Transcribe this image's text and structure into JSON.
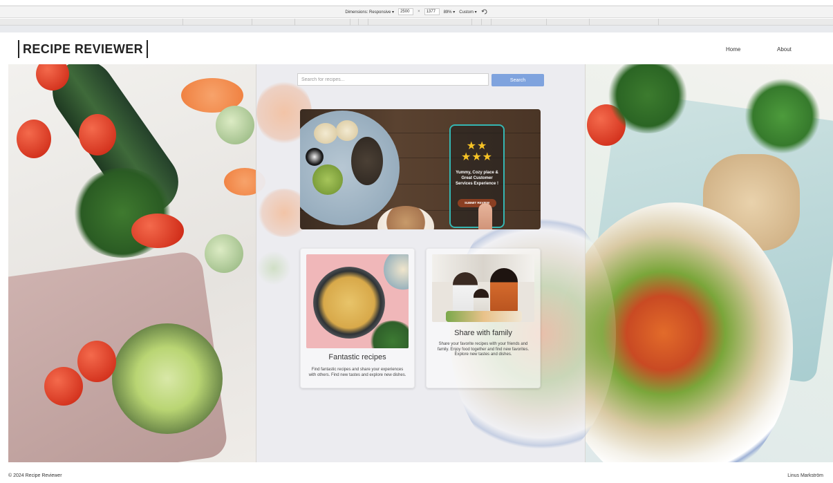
{
  "devtools": {
    "dimensions_label": "Dimensions: Responsive ▾",
    "width": "2500",
    "times": "×",
    "height": "1377",
    "zoom": "89% ▾",
    "throttle": "Custom ▾"
  },
  "site": {
    "brand": "RECIPE REVIEWER",
    "nav": {
      "home": "Home",
      "about": "About"
    }
  },
  "search": {
    "placeholder": "Search for recipes...",
    "button_label": "Search"
  },
  "banner": {
    "stars": "★★\n★★★",
    "review_text": "Yummy, Cozy place & Great Customer Services Experience !",
    "submit_label": "SUBMIT REVIEW"
  },
  "cards": [
    {
      "title": "Fantastic recipes",
      "description": "Find fantastic recipes and share your experiences with others. Find new tastes and explore new dishes."
    },
    {
      "title": "Share with family",
      "description": "Share your favorite recipes with your friends and family. Enjoy food together and find new favorites. Explore new tastes and dishes."
    }
  ],
  "footer": {
    "copyright": "© 2024 Recipe Reviewer",
    "author": "Linus Markström"
  },
  "colors": {
    "search_button": "#7fa3de",
    "phone_border": "#35b7b3",
    "star": "#f7c325"
  }
}
